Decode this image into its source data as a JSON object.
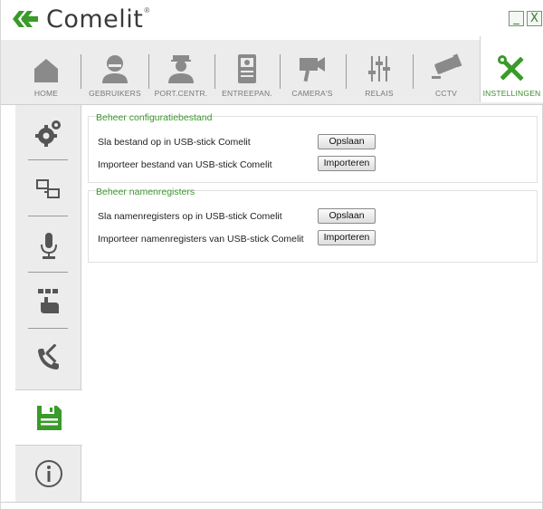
{
  "app": {
    "brand": "Comelit",
    "brand_mark": "®",
    "accent_color": "#3a9a2a",
    "window_controls": {
      "minimize": "_",
      "close": "X"
    }
  },
  "topnav": {
    "tabs": [
      {
        "label": "HOME",
        "icon": "home-icon"
      },
      {
        "label": "GEBRUIKERS",
        "icon": "user-icon"
      },
      {
        "label": "PORT.CENTR.",
        "icon": "concierge-icon"
      },
      {
        "label": "ENTREEPAN.",
        "icon": "entrance-panel-icon"
      },
      {
        "label": "CAMERA'S",
        "icon": "camera-icon"
      },
      {
        "label": "RELAIS",
        "icon": "relay-sliders-icon"
      },
      {
        "label": "CCTV",
        "icon": "cctv-icon"
      },
      {
        "label": "INSTELLINGEN",
        "icon": "tools-icon",
        "active": true
      }
    ]
  },
  "sidebar": {
    "items": [
      {
        "icon": "gears-icon"
      },
      {
        "icon": "network-devices-icon"
      },
      {
        "icon": "microphone-icon"
      },
      {
        "icon": "touch-keypad-icon"
      },
      {
        "icon": "phone-tools-icon"
      },
      {
        "icon": "save-disk-icon",
        "active": true
      },
      {
        "icon": "info-icon"
      }
    ]
  },
  "main": {
    "config_group": {
      "title": "Beheer configuratiebestand",
      "save_text": "Sla bestand op in USB-stick Comelit",
      "save_button": "Opslaan",
      "import_text": "Importeer bestand van USB-stick Comelit",
      "import_button": "Importeren"
    },
    "names_group": {
      "title": "Beheer namenregisters",
      "save_text": "Sla namenregisters op in USB-stick Comelit",
      "save_button": "Opslaan",
      "import_text": "Importeer namenregisters van USB-stick Comelit",
      "import_button": "Importeren"
    }
  }
}
